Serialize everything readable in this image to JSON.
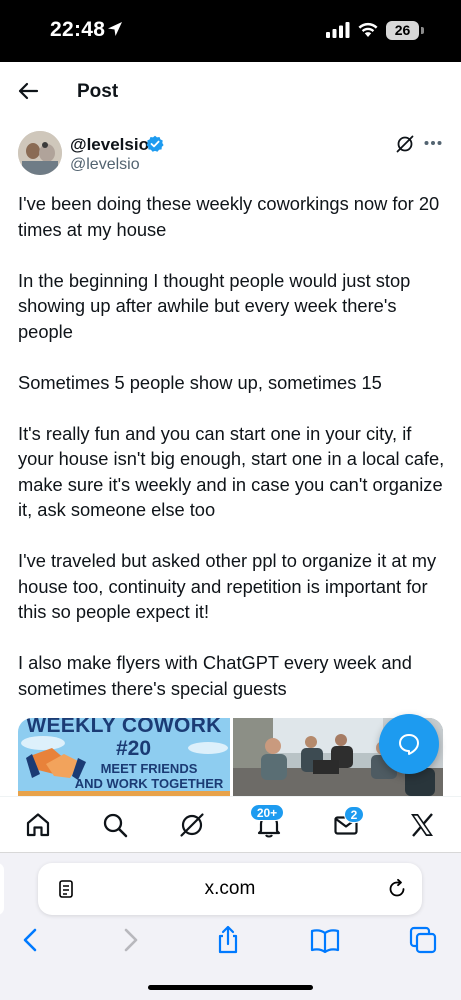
{
  "status_bar": {
    "time": "22:48",
    "battery": "26"
  },
  "header": {
    "title": "Post"
  },
  "author": {
    "name": "@levelsio",
    "handle": "@levelsio"
  },
  "post": {
    "paragraphs": [
      "I've been doing these weekly coworkings now for 20 times at my house",
      "In the beginning I thought people would just stop showing up after awhile but every week there's people",
      "Sometimes 5 people show up, sometimes 15",
      "It's really fun and you can start one in your city, if your house isn't big enough, start one in a local cafe, make sure it's weekly and in case you can't organize it, ask someone else too",
      "I've traveled but asked other ppl to organize it at my house too, continuity and repetition is important for this so people expect it!",
      "I also make flyers with ChatGPT every week and sometimes there's special guests"
    ]
  },
  "media": {
    "flyer_title": "WEEKLY COWORK",
    "flyer_number": "#20",
    "flyer_line1": "MEET FRIENDS",
    "flyer_line2": "AND WORK TOGETHER"
  },
  "tabbar": {
    "notifications_badge": "20+",
    "messages_badge": "2"
  },
  "safari": {
    "url": "x.com"
  },
  "colors": {
    "accent": "#1d9bf0",
    "text": "#0f1419",
    "secondary_text": "#536471",
    "safari_blue": "#007aff"
  }
}
